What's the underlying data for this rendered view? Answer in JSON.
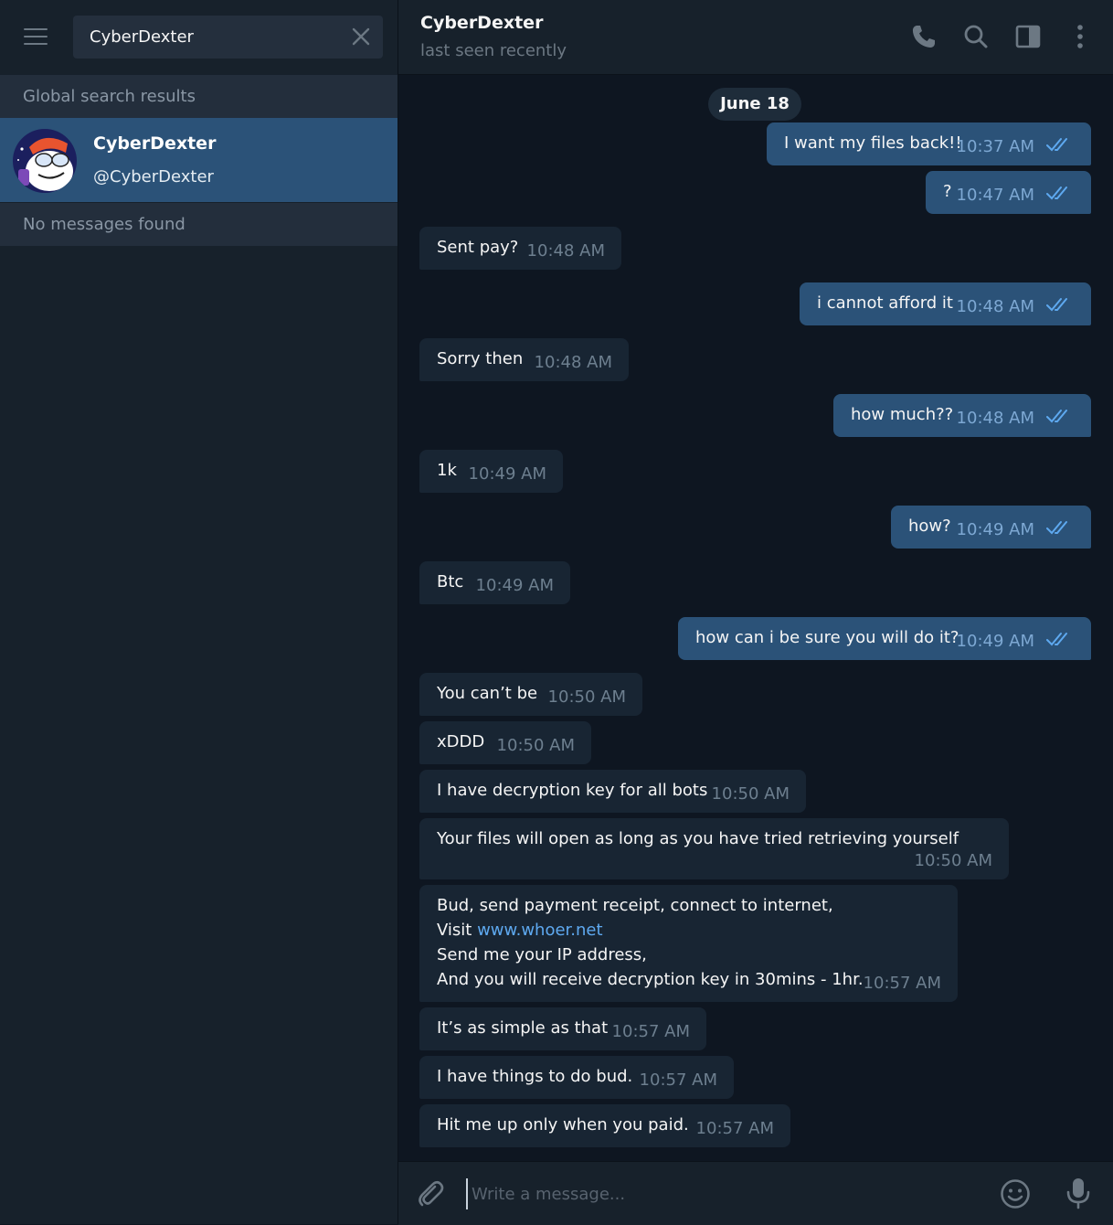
{
  "search": {
    "value": "CyberDexter"
  },
  "sidebar": {
    "global_header": "Global search results",
    "result": {
      "name": "CyberDexter",
      "handle": "@CyberDexter"
    },
    "messages_header": "No messages found"
  },
  "chat": {
    "title": "CyberDexter",
    "status": "last seen recently",
    "date": "June 18"
  },
  "messages": [
    {
      "dir": "out",
      "text": "I want my files back!!",
      "time": "10:37 AM"
    },
    {
      "dir": "out",
      "text": "?",
      "time": "10:47 AM"
    },
    {
      "dir": "in",
      "text": "Sent pay?",
      "time": "10:48 AM"
    },
    {
      "dir": "out",
      "text": "i cannot afford it",
      "time": "10:48 AM"
    },
    {
      "dir": "in",
      "text": "Sorry then",
      "time": "10:48 AM"
    },
    {
      "dir": "out",
      "text": "how much??",
      "time": "10:48 AM"
    },
    {
      "dir": "in",
      "text": "1k",
      "time": "10:49 AM"
    },
    {
      "dir": "out",
      "text": "how?",
      "time": "10:49 AM"
    },
    {
      "dir": "in",
      "text": "Btc",
      "time": "10:49 AM"
    },
    {
      "dir": "out",
      "text": "how can i be sure you will do it?",
      "time": "10:49 AM"
    },
    {
      "dir": "in",
      "text": "You can’t be",
      "time": "10:50 AM"
    },
    {
      "dir": "in",
      "text": "xDDD",
      "time": "10:50 AM"
    },
    {
      "dir": "in",
      "text": "I have decryption key for all bots",
      "time": "10:50 AM"
    },
    {
      "dir": "in",
      "text": "Your files will open as long as you have tried retrieving yourself",
      "time": "10:50 AM"
    },
    {
      "dir": "in",
      "line1": "Bud, send payment receipt, connect to internet,",
      "line2_prefix": "Visit ",
      "link": "www.whoer.net",
      "line3": "Send me your IP address,",
      "line4": "And you will receive decryption key in 30mins - 1hr.",
      "time": "10:57 AM"
    },
    {
      "dir": "in",
      "text": "It’s as simple as that",
      "time": "10:57 AM"
    },
    {
      "dir": "in",
      "text": "I have things to do bud.",
      "time": "10:57 AM"
    },
    {
      "dir": "in",
      "text": "Hit me up only when you paid.",
      "time": "10:57 AM"
    }
  ],
  "composer": {
    "placeholder": "Write a message..."
  },
  "colors": {
    "sidebar_bg": "#17212b",
    "chat_bg": "#0e1621",
    "outgoing_bubble": "#2b5278",
    "incoming_bubble": "#182533",
    "link": "#5ea9f0"
  },
  "icons": [
    "menu-icon",
    "close-icon",
    "phone-icon",
    "search-icon",
    "sidebar-toggle-icon",
    "more-vertical-icon",
    "paperclip-icon",
    "emoji-icon",
    "microphone-icon",
    "double-check-icon"
  ]
}
